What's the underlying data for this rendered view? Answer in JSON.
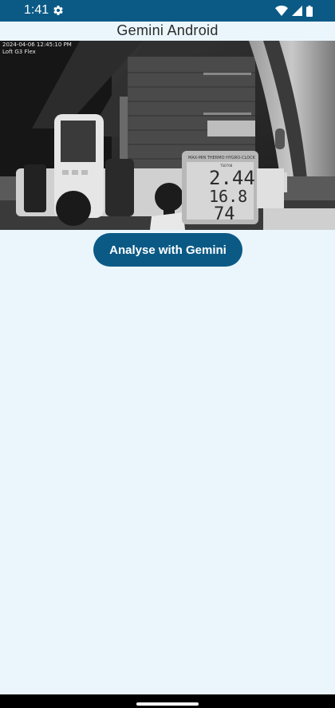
{
  "status_bar": {
    "time": "1:41",
    "icons": [
      "gear-icon",
      "wifi-icon",
      "signal-icon",
      "battery-icon"
    ],
    "background": "#0b5a86"
  },
  "app": {
    "title": "Gemini Android"
  },
  "camera_feed": {
    "timestamp": "2024-04-06  12:45:10 PM",
    "camera_name": "Loft G3 Flex"
  },
  "meter_display": {
    "brand_text": "MAX-MIN  THERMO  HYGRO-CLOCK",
    "model_text": "TS0708",
    "row1": "2.44",
    "row2": "16.8",
    "row3": "74"
  },
  "actions": {
    "analyse_label": "Analyse with Gemini"
  },
  "colors": {
    "accent": "#0b5a86",
    "background": "#eaf6fc"
  }
}
